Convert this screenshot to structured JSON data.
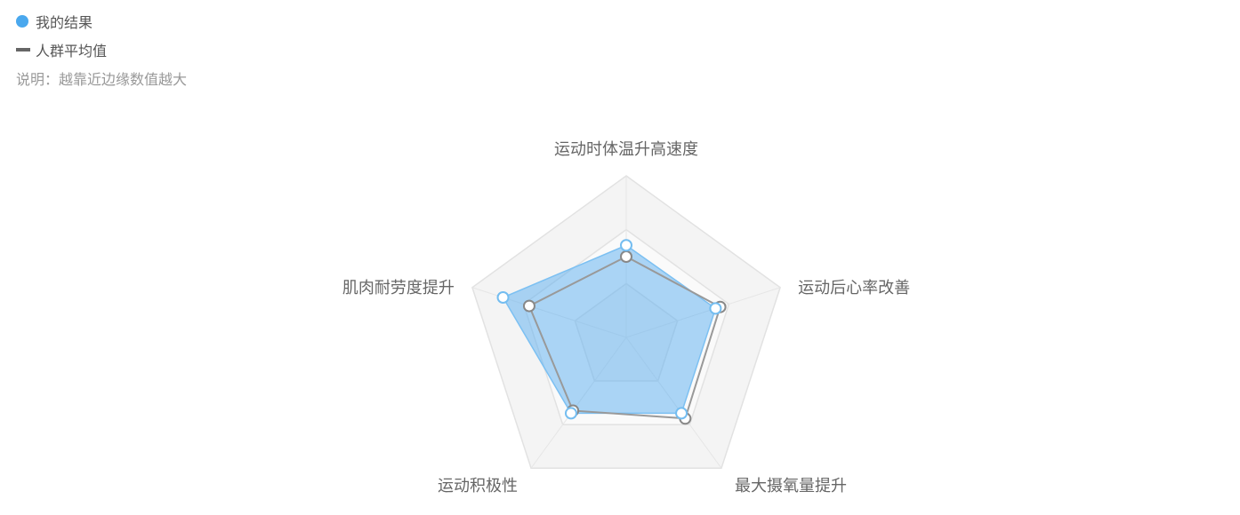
{
  "legend": {
    "mine": {
      "label": "我的结果",
      "color": "#5aaef0"
    },
    "avg": {
      "label": "人群平均值",
      "color": "#666666"
    },
    "note": "说明：越靠近边缘数值越大"
  },
  "chart_data": {
    "type": "radar",
    "axes": [
      "运动时体温升高速度",
      "运动后心率改善",
      "最大摄氧量提升",
      "运动积极性",
      "肌肉耐劳度提升"
    ],
    "max": 100,
    "rings": [
      33.3,
      66.7,
      100
    ],
    "series": [
      {
        "name": "我的结果",
        "values": [
          57,
          58,
          58,
          58,
          80
        ],
        "color": "#5aaef0"
      },
      {
        "name": "人群平均值",
        "values": [
          50,
          61,
          62,
          56,
          63
        ],
        "color": "#8a8a8a"
      }
    ]
  }
}
